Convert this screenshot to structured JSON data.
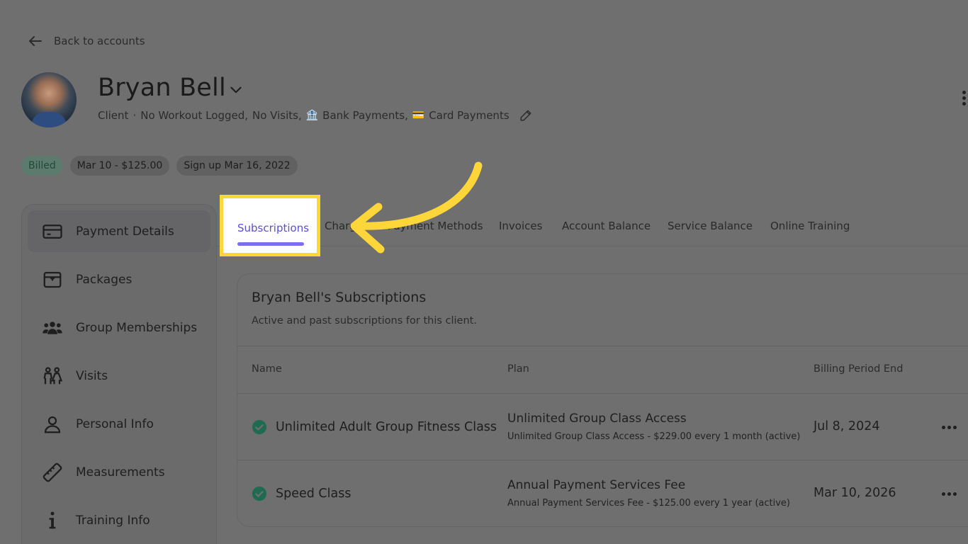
{
  "back_link": "Back to accounts",
  "client": {
    "name": "Bryan Bell",
    "role": "Client",
    "separator": "·",
    "workout": "No Workout Logged,",
    "visits": "No Visits,",
    "bank_emoji": "🏦",
    "bank": "Bank Payments,",
    "card_emoji": "💳",
    "card": "Card Payments"
  },
  "chips": {
    "billed": "Billed",
    "last_payment": "Mar 10 - $125.00",
    "signup": "Sign up Mar 16, 2022"
  },
  "sidebar": {
    "items": [
      {
        "label": "Payment Details",
        "icon": "credit-card-icon"
      },
      {
        "label": "Packages",
        "icon": "package-icon"
      },
      {
        "label": "Group Memberships",
        "icon": "group-icon"
      },
      {
        "label": "Visits",
        "icon": "people-icon"
      },
      {
        "label": "Personal Info",
        "icon": "person-icon"
      },
      {
        "label": "Measurements",
        "icon": "ruler-icon"
      },
      {
        "label": "Training Info",
        "icon": "info-icon"
      }
    ]
  },
  "tabs": [
    "Subscriptions",
    "Charges",
    "Payment Methods",
    "Invoices",
    "Account Balance",
    "Service Balance",
    "Online Training"
  ],
  "card": {
    "title": "Bryan Bell's Subscriptions",
    "subtitle": "Active and past subscriptions for this client.",
    "headers": {
      "name": "Name",
      "plan": "Plan",
      "period": "Billing Period End"
    },
    "rows": [
      {
        "name": "Unlimited Adult Group Fitness Class",
        "plan": "Unlimited Group Class Access",
        "plan_detail": "Unlimited Group Class Access - $229.00 every 1 month (active)",
        "period": "Jul 8, 2024"
      },
      {
        "name": "Speed Class",
        "plan": "Annual Payment Services Fee",
        "plan_detail": "Annual Payment Services Fee - $125.00 every 1 year (active)",
        "period": "Mar 10, 2026"
      }
    ]
  },
  "colors": {
    "accent": "#5b4fd6",
    "highlight": "#ffd63a",
    "overlay": "#6f6f6f",
    "status_green": "#1f7a5a"
  }
}
